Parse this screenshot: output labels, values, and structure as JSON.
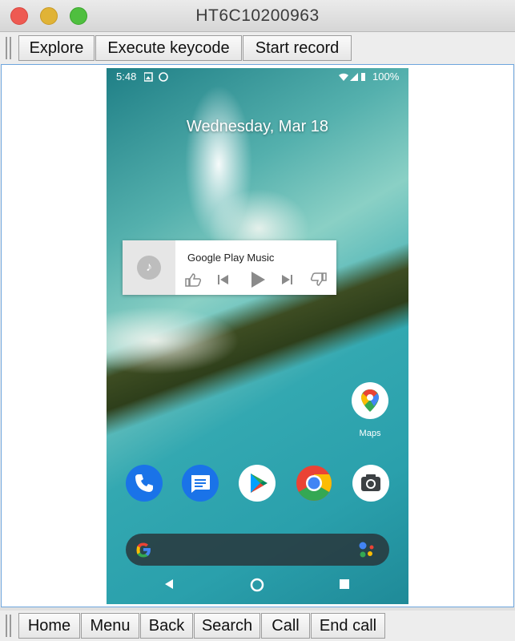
{
  "window": {
    "title": "HT6C10200963"
  },
  "toolbar_top": {
    "buttons": [
      "Explore",
      "Execute keycode",
      "Start record"
    ]
  },
  "toolbar_bottom": {
    "buttons": [
      "Home",
      "Menu",
      "Back",
      "Search",
      "Call",
      "End call"
    ]
  },
  "phone": {
    "status": {
      "time": "5:48",
      "battery": "100%"
    },
    "date": "Wednesday, Mar 18",
    "music_widget": {
      "title": "Google Play Music"
    },
    "shortcut": {
      "label": "Maps"
    },
    "colors": {
      "phone_blue": "#1a73e8",
      "messages_blue": "#1a73e8",
      "chrome_red": "#ea4335",
      "chrome_yellow": "#fbbc04",
      "chrome_green": "#34a853"
    }
  }
}
